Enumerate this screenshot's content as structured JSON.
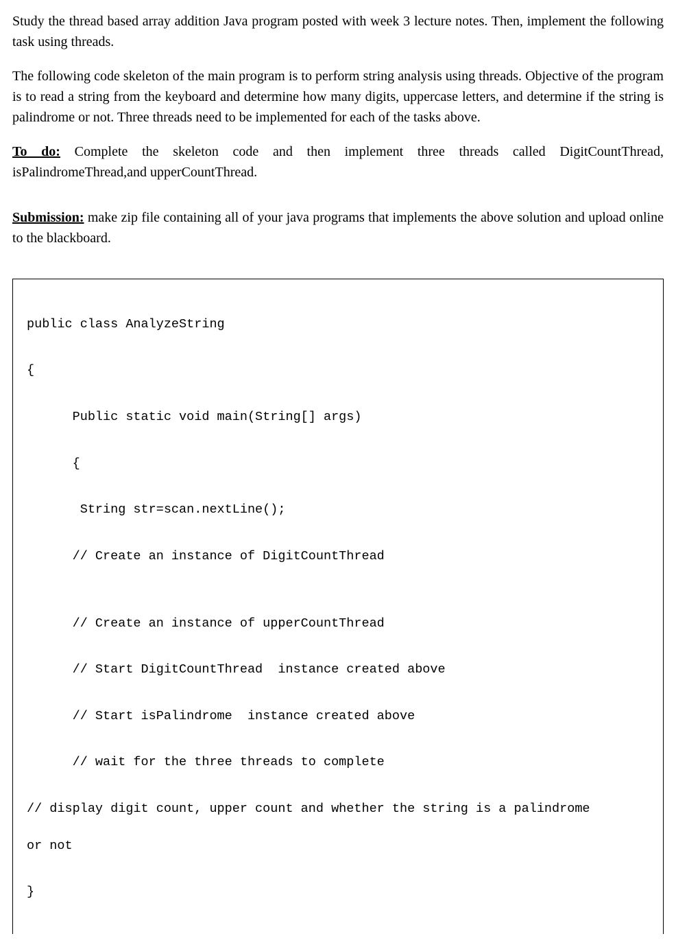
{
  "paragraphs": {
    "intro": "Study the thread based array addition Java program posted with week 3 lecture notes. Then, implement the following task using threads.",
    "description": "The following code skeleton of the main program is to perform string analysis using threads. Objective of the program is to read a string from the keyboard and determine how many digits, uppercase letters, and determine if the string is palindrome or not. Three threads need to be implemented for each of the tasks above.",
    "todo_label": "To do:",
    "todo_text": " Complete the skeleton code and then implement three threads called DigitCountThread, isPalindromeThread,and upperCountThread.",
    "submission_label": "Submission:",
    "submission_text": " make zip file containing all of your java programs that implements the above solution and upload online to the blackboard."
  },
  "code": {
    "l1": "public class AnalyzeString",
    "l2": "{",
    "l3": "      Public static void main(String[] args)",
    "l4": "      {",
    "l5": "       String str=scan.nextLine();",
    "l6": "      // Create an instance of DigitCountThread",
    "l7": "      // Create an instance of upperCountThread",
    "l8": "      // Start DigitCountThread  instance created above",
    "l9": "      // Start isPalindrome  instance created above",
    "l10": "      // wait for the three threads to complete",
    "l11": "// display digit count, upper count and whether the string is a palindrome",
    "l12": "or not",
    "l13": "}"
  }
}
